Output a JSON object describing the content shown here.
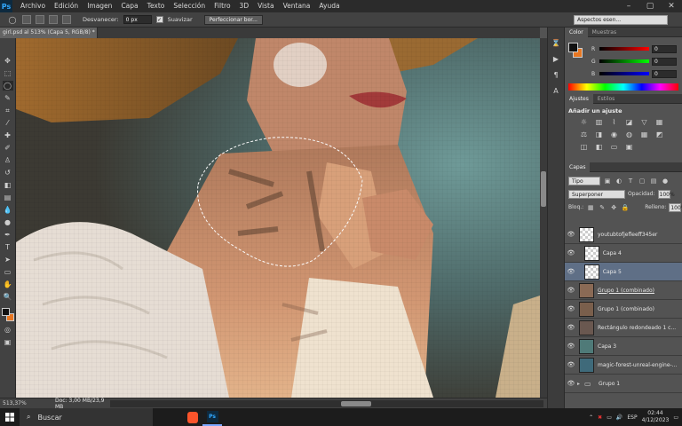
{
  "app": {
    "logo": "Ps"
  },
  "menu": [
    "Archivo",
    "Edición",
    "Imagen",
    "Capa",
    "Texto",
    "Selección",
    "Filtro",
    "3D",
    "Vista",
    "Ventana",
    "Ayuda"
  ],
  "options": {
    "feather_label": "Desvanecer:",
    "feather_value": "0 px",
    "smooth_label": "Suavizar",
    "refine_label": "Perfeccionar bor...",
    "workspace": "Aspectos esen..."
  },
  "document": {
    "tab": "girl.psd al 513% (Capa 5, RGB/8) *"
  },
  "status": {
    "zoom": "513,37%",
    "doc": "Doc: 3,00 MB/23,9 MB"
  },
  "color_panel": {
    "tabs": [
      "Color",
      "Muestras"
    ],
    "channels": [
      {
        "label": "R",
        "value": "0"
      },
      {
        "label": "G",
        "value": "0"
      },
      {
        "label": "B",
        "value": "0"
      }
    ],
    "fg": "#111111",
    "bg": "#e87722"
  },
  "adjust_panel": {
    "tabs": [
      "Ajustes",
      "Estilos"
    ],
    "title": "Añadir un ajuste",
    "icons": [
      "brightness-icon",
      "levels-icon",
      "curves-icon",
      "exposure-icon",
      "vibrance-icon",
      "hue-icon",
      "balance-icon",
      "bw-icon",
      "photo-filter-icon",
      "mixer-icon",
      "lookup-icon",
      "invert-icon",
      "posterize-icon",
      "threshold-icon",
      "gradient-map-icon",
      "selective-color-icon"
    ]
  },
  "layers_panel": {
    "tab": "Capas",
    "kind_filter": "Tipo",
    "blend_mode": "Superponer",
    "opacity_label": "Opacidad:",
    "opacity_value": "100%",
    "lock_label": "Bloq.:",
    "fill_label": "Relleno:",
    "fill_value": "100%",
    "layers": [
      {
        "name": "youtubtofjefleeff345er",
        "selected": false,
        "underline": false
      },
      {
        "name": "Capa 4",
        "selected": false,
        "underline": false
      },
      {
        "name": "Capa 5",
        "selected": true,
        "underline": false
      },
      {
        "name": "Grupo 1 (combinado)",
        "selected": false,
        "underline": true
      },
      {
        "name": "Grupo 1 (combinado)",
        "selected": false,
        "underline": false
      },
      {
        "name": "Rectángulo redondeado 1 c...",
        "selected": false,
        "underline": false
      },
      {
        "name": "Capa 3",
        "selected": false,
        "underline": false
      },
      {
        "name": "magic-forest-unreal-engine-...",
        "selected": false,
        "underline": false
      },
      {
        "name": "Grupo 1",
        "selected": false,
        "underline": false
      }
    ]
  },
  "taskbar": {
    "search_placeholder": "Buscar",
    "lang": "ESP",
    "time": "02:44",
    "date": "4/12/2023"
  }
}
